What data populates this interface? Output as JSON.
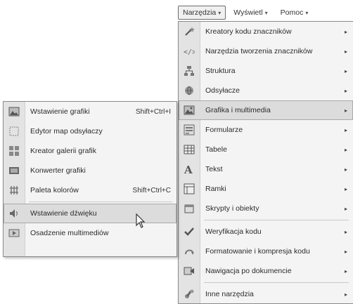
{
  "menubar": {
    "items": [
      {
        "label": "Narzędzia",
        "caret": "▾",
        "active": true
      },
      {
        "label": "Wyświetl",
        "caret": "▾",
        "active": false
      },
      {
        "label": "Pomoc",
        "caret": "▾",
        "active": false
      }
    ]
  },
  "main_menu": {
    "items": [
      {
        "label": "Kreatory kodu znaczników",
        "icon": "wand-icon",
        "arrow": "▸"
      },
      {
        "label": "Narzędzia tworzenia znaczników",
        "icon": "markup-tools-icon",
        "arrow": "▸"
      },
      {
        "label": "Struktura",
        "icon": "structure-icon",
        "arrow": "▸"
      },
      {
        "label": "Odsyłacze",
        "icon": "link-icon",
        "arrow": "▸"
      },
      {
        "label": "Grafika i multimedia",
        "icon": "image-icon",
        "arrow": "▸"
      },
      {
        "label": "Formularze",
        "icon": "form-icon",
        "arrow": "▸"
      },
      {
        "label": "Tabele",
        "icon": "table-icon",
        "arrow": "▸"
      },
      {
        "label": "Tekst",
        "icon": "text-icon",
        "arrow": "▸"
      },
      {
        "label": "Ramki",
        "icon": "frames-icon",
        "arrow": "▸"
      },
      {
        "label": "Skrypty i obiekty",
        "icon": "scripts-icon",
        "arrow": "▸"
      },
      {
        "label": "Weryfikacja kodu",
        "icon": "validate-icon",
        "arrow": "▸"
      },
      {
        "label": "Formatowanie i kompresja kodu",
        "icon": "format-icon",
        "arrow": "▸"
      },
      {
        "label": "Nawigacja po dokumencie",
        "icon": "navigation-icon",
        "arrow": "▸"
      },
      {
        "label": "Inne narzędzia",
        "icon": "other-tools-icon",
        "arrow": "▸"
      }
    ]
  },
  "sub_menu": {
    "items": [
      {
        "label": "Wstawienie grafiki",
        "shortcut": "Shift+Ctrl+I",
        "icon": "insert-image-icon"
      },
      {
        "label": "Edytor map odsyłaczy",
        "shortcut": "",
        "icon": "image-map-icon"
      },
      {
        "label": "Kreator galerii grafik",
        "shortcut": "",
        "icon": "gallery-icon"
      },
      {
        "label": "Konwerter grafiki",
        "shortcut": "",
        "icon": "converter-icon"
      },
      {
        "label": "Paleta kolorów",
        "shortcut": "Shift+Ctrl+C",
        "icon": "palette-icon"
      },
      {
        "label": "Wstawienie dźwięku",
        "shortcut": "",
        "icon": "sound-icon"
      },
      {
        "label": "Osadzenie multimediów",
        "shortcut": "",
        "icon": "multimedia-icon"
      }
    ]
  }
}
